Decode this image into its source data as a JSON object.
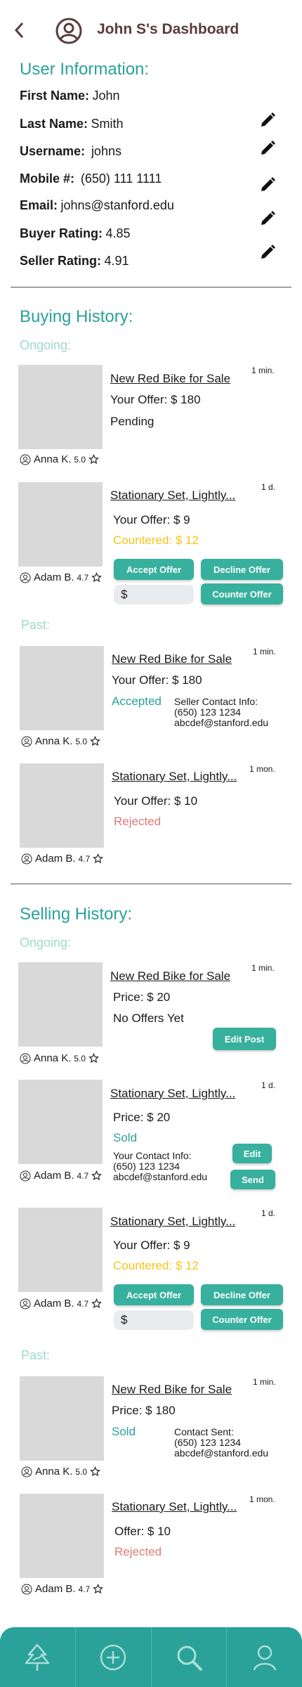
{
  "header": {
    "title": "John S's Dashboard"
  },
  "user_info": {
    "title": "User Information:",
    "first_name_label": "First Name:",
    "first_name": "John",
    "last_name_label": "Last Name:",
    "last_name": "Smith",
    "username_label": "Username:",
    "username": "johns",
    "mobile_label": "Mobile #:",
    "mobile": "(650) 111 1111",
    "email_label": "Email:",
    "email": "johns@stanford.edu",
    "buyer_rating_label": "Buyer Rating:",
    "buyer_rating": "4.85",
    "seller_rating_label": "Seller Rating:",
    "seller_rating": "4.91"
  },
  "buying": {
    "title": "Buying History:",
    "ongoing_label": "Ongoing:",
    "past_label": "Past:",
    "items": [
      {
        "title": "New Red Bike for Sale",
        "age": "1 min.",
        "line1": "Your Offer: $ 180",
        "status": "Pending",
        "user": "Anna K.",
        "rating": "5.0"
      },
      {
        "title": "Stationary Set, Lightly...",
        "age": "1 d.",
        "line1": "Your Offer: $ 9",
        "status": "Countered: $ 12",
        "user": "Adam B.",
        "rating": "4.7",
        "accept": "Accept Offer",
        "decline": "Decline Offer",
        "counter": "Counter Offer",
        "input": "$"
      },
      {
        "title": "New Red Bike for Sale",
        "age": "1 min.",
        "line1": "Your Offer: $ 180",
        "status": "Accepted",
        "contact": "Seller Contact Info:",
        "phone": "(650) 123 1234",
        "email": "abcdef@stanford.edu",
        "user": "Anna K.",
        "rating": "5.0"
      },
      {
        "title": "Stationary Set, Lightly...",
        "age": "1 mon.",
        "line1": "Your Offer: $ 10",
        "status": "Rejected",
        "user": "Adam B.",
        "rating": "4.7"
      }
    ]
  },
  "selling": {
    "title": "Selling History:",
    "ongoing_label": "Ongoing:",
    "past_label": "Past:",
    "items": [
      {
        "title": "New Red Bike for Sale",
        "age": "1 min.",
        "line1": "Price: $  20",
        "status": "No Offers Yet",
        "button": "Edit Post",
        "user": "Anna K.",
        "rating": "5.0"
      },
      {
        "title": "Stationary Set, Lightly...",
        "age": "1 d.",
        "line1": "Price: $  20",
        "status": "Sold",
        "contact": "Your Contact Info:",
        "phone": "(650) 123 1234",
        "email": "abcdef@stanford.edu",
        "edit": "Edit",
        "send": "Send",
        "user": "Adam B.",
        "rating": "4.7"
      },
      {
        "title": "Stationary Set, Lightly...",
        "age": "1 d.",
        "line1": "Your Offer: $ 9",
        "status": "Countered: $ 12",
        "accept": "Accept Offer",
        "decline": "Decline Offer",
        "counter": "Counter Offer",
        "input": "$",
        "user": "Adam B.",
        "rating": "4.7"
      },
      {
        "title": "New Red Bike for Sale",
        "age": "1 min.",
        "line1": "Price: $  180",
        "status": "Sold",
        "contact": "Contact Sent:",
        "phone": "(650) 123 1234",
        "email": "abcdef@stanford.edu",
        "user": "Anna K.",
        "rating": "5.0"
      },
      {
        "title": "Stationary Set, Lightly...",
        "age": "1 mon.",
        "line1": "Offer: $  10",
        "status": "Rejected",
        "user": "Adam B.",
        "rating": "4.7"
      }
    ]
  },
  "nav": {
    "items": [
      "tree-icon",
      "add-icon",
      "search-icon",
      "profile-icon"
    ]
  },
  "colors": {
    "accent": "#2aa199",
    "title": "#5a3b3b",
    "countered": "#f5c518",
    "rejected": "#e07a7a"
  }
}
